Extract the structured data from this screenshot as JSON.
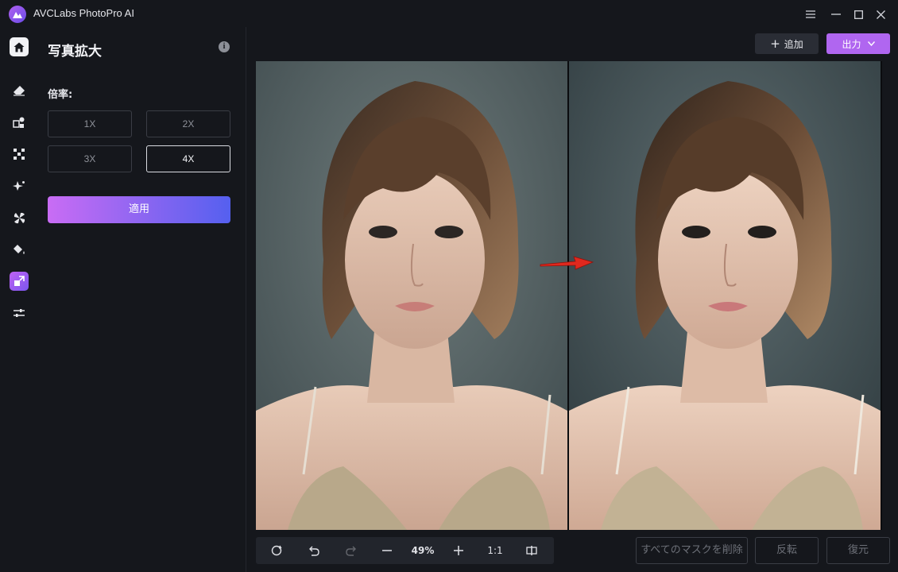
{
  "app": {
    "title": "AVCLabs PhotoPro AI"
  },
  "window_controls": [
    "menu-icon",
    "minimize-icon",
    "maximize-icon",
    "close-icon"
  ],
  "rail": {
    "items": [
      {
        "name": "home",
        "icon": "home-icon"
      },
      {
        "name": "object-remover",
        "icon": "eraser-icon"
      },
      {
        "name": "replace",
        "icon": "replace-icon"
      },
      {
        "name": "background",
        "icon": "background-icon"
      },
      {
        "name": "enhance",
        "icon": "sparkle-icon"
      },
      {
        "name": "colorize",
        "icon": "fan-icon"
      },
      {
        "name": "fill",
        "icon": "paint-bucket-icon"
      },
      {
        "name": "upscale",
        "icon": "upscale-icon",
        "active": true
      },
      {
        "name": "adjust",
        "icon": "sliders-icon"
      }
    ]
  },
  "panel": {
    "title": "写真拡大",
    "scale_label": "倍率:",
    "scale_options": [
      {
        "label": "1X",
        "selected": false
      },
      {
        "label": "2X",
        "selected": false
      },
      {
        "label": "3X",
        "selected": false
      },
      {
        "label": "4X",
        "selected": true
      }
    ],
    "apply_label": "適用"
  },
  "header": {
    "add_label": "追加",
    "export_label": "出力"
  },
  "toolbar": {
    "zoom": "49%",
    "ratio": "1:1"
  },
  "actions": {
    "remove_masks": "すべてのマスクを削除",
    "invert": "反転",
    "restore": "復元"
  },
  "colors": {
    "accent": "#b066f0",
    "background": "#15171c",
    "arrow": "#e0281e"
  }
}
